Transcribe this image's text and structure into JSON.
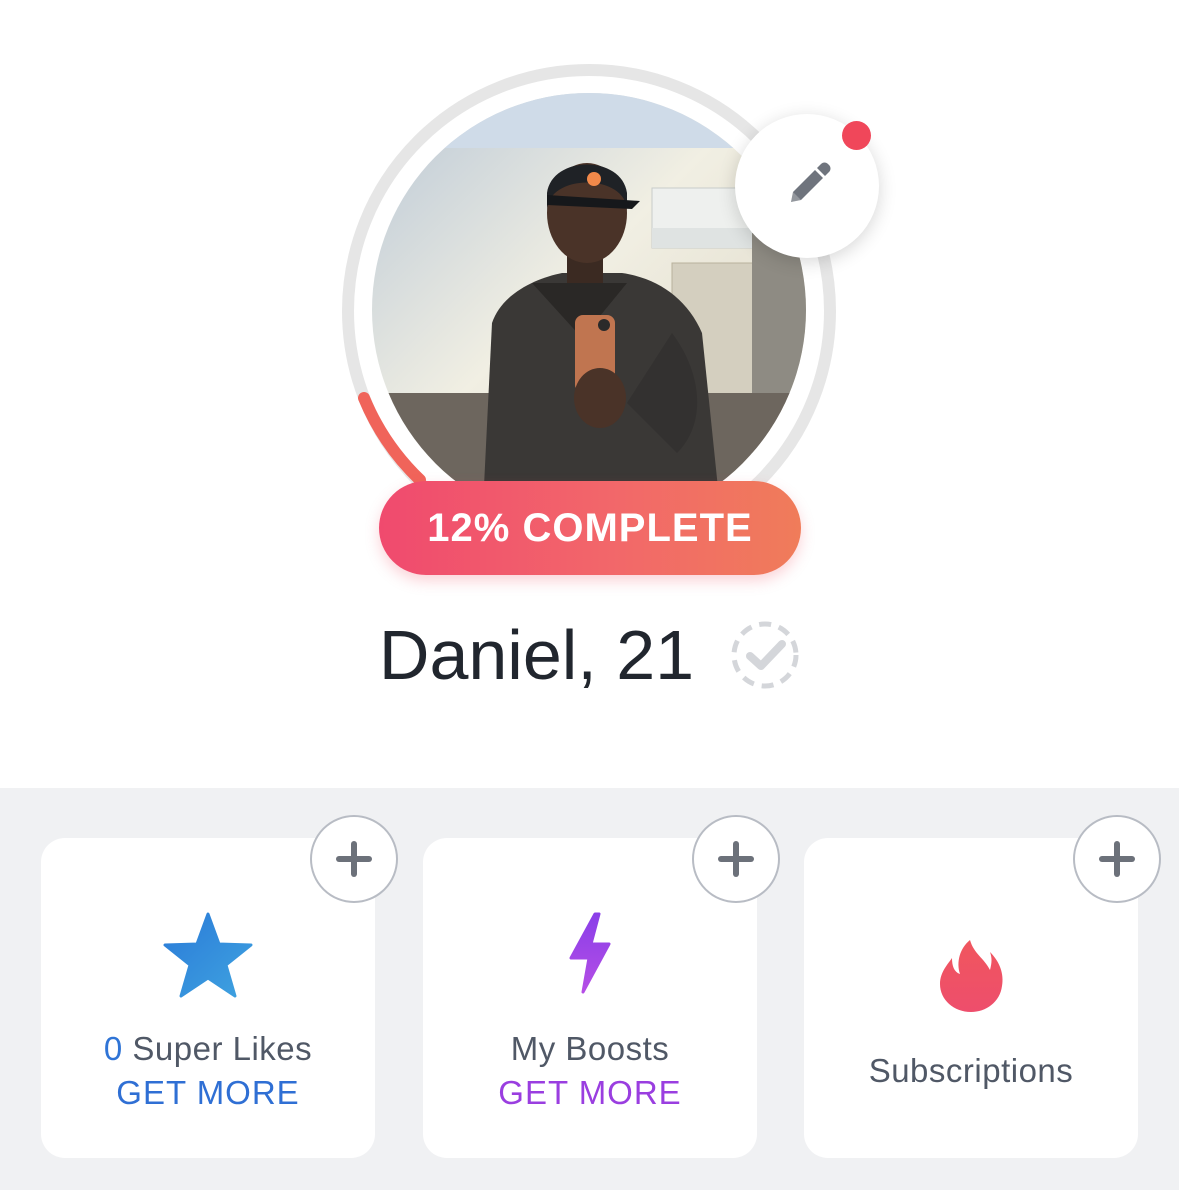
{
  "profile": {
    "name_age": "Daniel, 21",
    "completion_label": "12% COMPLETE",
    "completion_percent": 12,
    "has_notification": true
  },
  "cards": {
    "super_likes": {
      "count": "0",
      "label": " Super Likes",
      "action": "GET MORE"
    },
    "boosts": {
      "label": "My Boosts",
      "action": "GET MORE"
    },
    "subscriptions": {
      "label": "Subscriptions"
    }
  },
  "colors": {
    "accent_gradient_start": "#f04a6e",
    "accent_gradient_end": "#f07c5a",
    "super_like_blue": "#2f6fd4",
    "boost_purple": "#9a3ee0",
    "background_gray": "#f0f1f3"
  },
  "icons": {
    "edit": "pencil-icon",
    "verify": "verified-check-icon",
    "add": "plus-icon",
    "super_like": "star-icon",
    "boost": "lightning-icon",
    "subscription": "flame-icon"
  }
}
